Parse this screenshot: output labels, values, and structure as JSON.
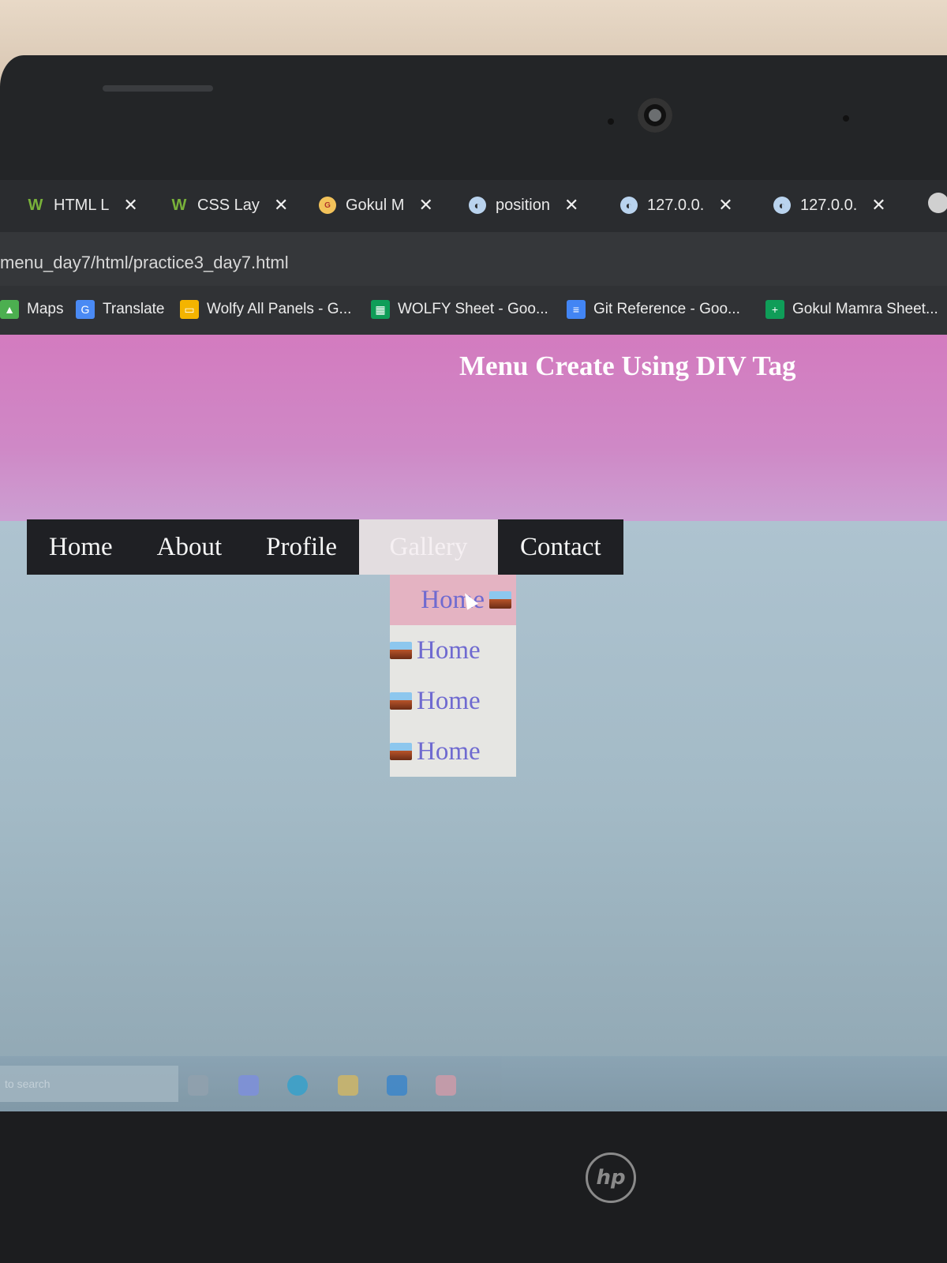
{
  "browser": {
    "tabs": [
      {
        "label": "HTML L",
        "icon": "w3schools-icon"
      },
      {
        "label": "CSS Lay",
        "icon": "w3schools-icon"
      },
      {
        "label": "Gokul M",
        "icon": "gokul-icon"
      },
      {
        "label": "position",
        "icon": "globe-icon"
      },
      {
        "label": "127.0.0.",
        "icon": "globe-icon"
      },
      {
        "label": "127.0.0.",
        "icon": "globe-icon"
      }
    ],
    "close_symbol": "✕",
    "url": "menu_day7/html/practice3_day7.html",
    "bookmarks": [
      {
        "label": "Maps",
        "icon": "maps-icon",
        "color": "#4caf50"
      },
      {
        "label": "Translate",
        "icon": "translate-icon",
        "color": "#4a8af4"
      },
      {
        "label": "Wolfy All Panels - G...",
        "icon": "slides-icon",
        "color": "#f4b400"
      },
      {
        "label": "WOLFY Sheet - Goo...",
        "icon": "sheets-icon",
        "color": "#0f9d58"
      },
      {
        "label": "Git Reference - Goo...",
        "icon": "docs-icon",
        "color": "#4285f4"
      },
      {
        "label": "Gokul Mamra Sheet...",
        "icon": "sheets-icon",
        "color": "#0f9d58"
      }
    ]
  },
  "page": {
    "title": "Menu Create Using DIV Tag",
    "menu": [
      "Home",
      "About",
      "Profile",
      "Gallery",
      "Contact"
    ],
    "active_menu": "Gallery",
    "dropdown": [
      "Home",
      "Home",
      "Home",
      "Home"
    ]
  },
  "taskbar": {
    "search_placeholder": "to search"
  },
  "device": {
    "brand": "hp"
  },
  "colors": {
    "header": "#d37bbf",
    "menu_bg": "#1f2024",
    "dropdown_text": "#6f6ad0",
    "dropdown_hover": "#e4b3c2"
  }
}
